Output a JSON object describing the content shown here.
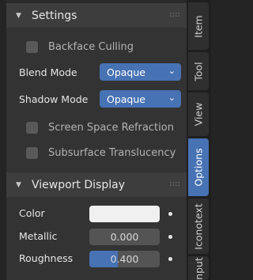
{
  "settings_panel": {
    "title": "Settings",
    "backface_culling": {
      "label": "Backface Culling",
      "checked": false
    },
    "blend_mode": {
      "label": "Blend Mode",
      "value": "Opaque"
    },
    "shadow_mode": {
      "label": "Shadow Mode",
      "value": "Opaque"
    },
    "screen_space_refraction": {
      "label": "Screen Space Refraction",
      "checked": false
    },
    "subsurface_translucency": {
      "label": "Subsurface Translucency",
      "checked": false
    }
  },
  "viewport_display_panel": {
    "title": "Viewport Display",
    "color": {
      "label": "Color",
      "value": "#f0f0f0"
    },
    "metallic": {
      "label": "Metallic",
      "value": "0.000",
      "fraction": 0.0
    },
    "roughness": {
      "label": "Roughness",
      "value": "0.400",
      "fraction": 0.4
    }
  },
  "tabs": [
    {
      "label": "Item",
      "active": false
    },
    {
      "label": "Tool",
      "active": false
    },
    {
      "label": "View",
      "active": false
    },
    {
      "label": "Options",
      "active": true
    },
    {
      "label": "Iconotext",
      "active": false
    },
    {
      "label": "nput",
      "active": false
    }
  ],
  "colors": {
    "accent": "#4772b3",
    "panel_header": "#3d3d3d",
    "panel_body": "#333333"
  },
  "icons": {
    "collapse": "chevron-down-icon",
    "drag": "drag-grip-icon",
    "dropdown": "chevron-down-icon",
    "keyframe": "animate-property-dot-icon"
  }
}
